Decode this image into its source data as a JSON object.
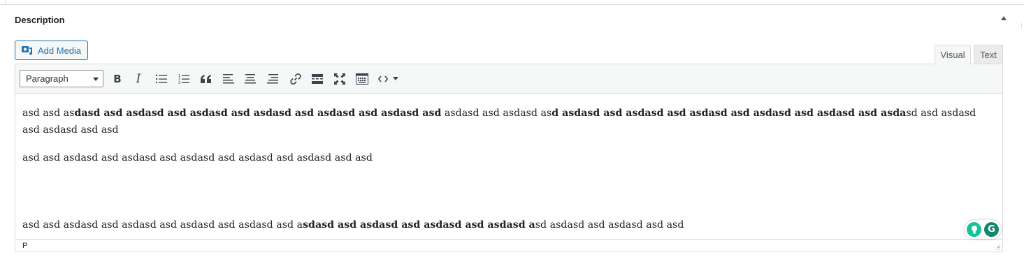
{
  "metabox": {
    "title": "Description"
  },
  "media": {
    "add_media_label": "Add Media"
  },
  "tabs": {
    "visual": "Visual",
    "text": "Text"
  },
  "toolbar": {
    "format_selected": "Paragraph",
    "bold_glyph": "B",
    "italic_glyph": "I",
    "buttons": [
      "bold",
      "italic",
      "bulleted-list",
      "numbered-list",
      "blockquote",
      "align-left",
      "align-center",
      "align-right",
      "insert-link",
      "read-more",
      "fullscreen",
      "toolbar-toggle",
      "code",
      "more-dropdown"
    ]
  },
  "content": {
    "p1": [
      {
        "t": "asd asd as",
        "b": false
      },
      {
        "t": "dasd asd asdasd asd asdasd asd asdasd asd asdasd asd asdasd asd",
        "b": true
      },
      {
        "t": " asdasd asd asdasd as",
        "b": false
      },
      {
        "t": "d asdasd asd asdasd asd asdasd asd asdasd asd asdasd asd asda",
        "b": true
      },
      {
        "t": "sd asd asdasd asd asdasd asd asd",
        "b": false
      }
    ],
    "p2": "asd asd asdasd asd asdasd asd asdasd asd asdasd asd asdasd asd asd",
    "p3": [
      {
        "t": "asd asd asdasd asd asdasd asd asdasd asd asdasd asd a",
        "b": false
      },
      {
        "t": "sdasd asd asdasd asd asdasd asd asdasd a",
        "b": true
      },
      {
        "t": "sd asdasd asd asdasd asd asd",
        "b": false
      }
    ]
  },
  "statusbar": {
    "path": "P"
  },
  "grammarly": {
    "logo_letter": "G"
  },
  "colors": {
    "accent": "#2271b1",
    "grammarly_green": "#15c39a",
    "grammarly_dark": "#15856d"
  }
}
